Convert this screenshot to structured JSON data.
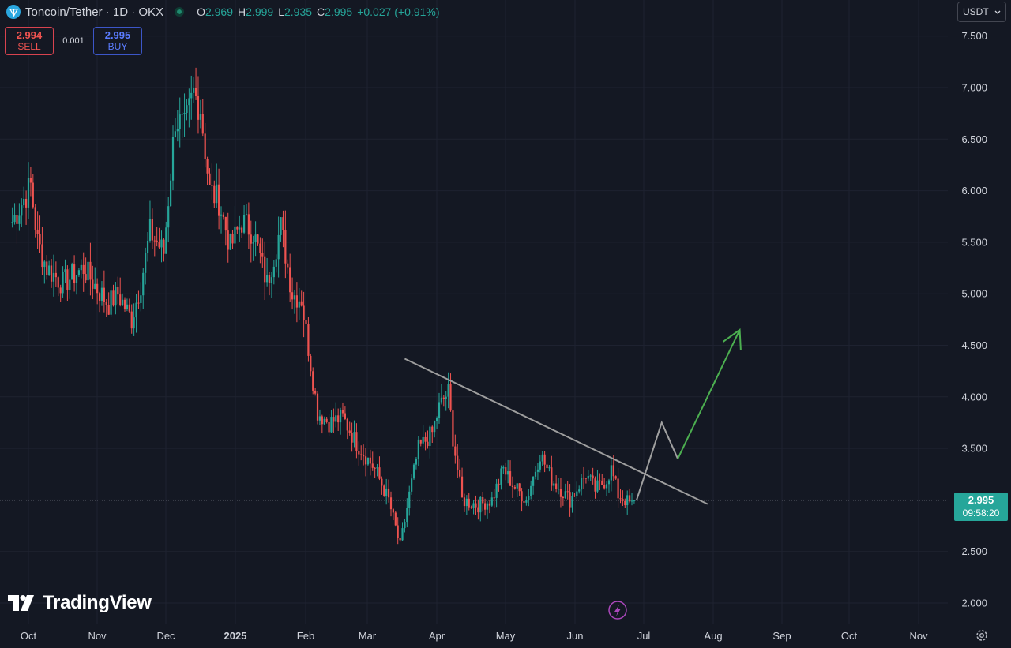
{
  "header": {
    "symbol": "Toncoin/Tether · 1D · OKX",
    "ohlc": [
      {
        "k": "O",
        "v": "2.969"
      },
      {
        "k": "H",
        "v": "2.999"
      },
      {
        "k": "L",
        "v": "2.935"
      },
      {
        "k": "C",
        "v": "2.995"
      }
    ],
    "change": "+0.027 (+0.91%)"
  },
  "trade": {
    "sell_price": "2.994",
    "sell_label": "SELL",
    "spread": "0.001",
    "buy_price": "2.995",
    "buy_label": "BUY"
  },
  "currency": "USDT",
  "last_price": {
    "value": "2.995",
    "countdown": "09:58:20"
  },
  "logo": "TradingView",
  "colors": {
    "background": "#141823",
    "up": "#26a69a",
    "down": "#ef5350",
    "trendline": "#9e9e9e",
    "projection_up": "#4caf50",
    "projection_path": "#a0a0a0"
  },
  "chart_data": {
    "type": "candlestick",
    "y_ticks": [
      "2.000",
      "2.500",
      "3.000",
      "3.500",
      "4.000",
      "4.500",
      "5.000",
      "5.500",
      "6.000",
      "6.500",
      "7.000",
      "7.500"
    ],
    "ylim": [
      2.0,
      7.5
    ],
    "x_ticks": [
      "Oct",
      "Nov",
      "Dec",
      "2025",
      "Feb",
      "Mar",
      "Apr",
      "May",
      "Jun",
      "Jul",
      "Aug",
      "Sep",
      "Oct",
      "Nov"
    ],
    "grid": true,
    "price_line": 2.995,
    "anchors": [
      [
        "2024-09-23",
        5.7
      ],
      [
        "2024-10-01",
        6.05
      ],
      [
        "2024-10-04",
        5.5
      ],
      [
        "2024-10-08",
        5.25
      ],
      [
        "2024-10-15",
        5.1
      ],
      [
        "2024-10-24",
        5.25
      ],
      [
        "2024-10-30",
        5.05
      ],
      [
        "2024-11-04",
        4.9
      ],
      [
        "2024-11-08",
        5.0
      ],
      [
        "2024-11-14",
        4.75
      ],
      [
        "2024-11-18",
        5.1
      ],
      [
        "2024-11-22",
        5.6
      ],
      [
        "2024-11-28",
        5.4
      ],
      [
        "2024-12-03",
        6.7
      ],
      [
        "2024-12-07",
        6.6
      ],
      [
        "2024-12-11",
        6.95
      ],
      [
        "2024-12-14",
        6.8
      ],
      [
        "2024-12-18",
        6.0
      ],
      [
        "2024-12-22",
        5.9
      ],
      [
        "2024-12-27",
        5.45
      ],
      [
        "2025-01-01",
        5.7
      ],
      [
        "2025-01-06",
        5.6
      ],
      [
        "2025-01-12",
        5.1
      ],
      [
        "2025-01-18",
        5.65
      ],
      [
        "2025-01-23",
        5.0
      ],
      [
        "2025-01-27",
        4.95
      ],
      [
        "2025-02-03",
        3.85
      ],
      [
        "2025-02-08",
        3.75
      ],
      [
        "2025-02-14",
        3.8
      ],
      [
        "2025-02-20",
        3.55
      ],
      [
        "2025-02-28",
        3.3
      ],
      [
        "2025-03-06",
        3.0
      ],
      [
        "2025-03-11",
        2.55
      ],
      [
        "2025-03-15",
        3.05
      ],
      [
        "2025-03-19",
        3.5
      ],
      [
        "2025-03-25",
        3.65
      ],
      [
        "2025-03-28",
        3.9
      ],
      [
        "2025-04-01",
        4.05
      ],
      [
        "2025-04-03",
        3.6
      ],
      [
        "2025-04-07",
        3.0
      ],
      [
        "2025-04-14",
        2.95
      ],
      [
        "2025-04-20",
        3.0
      ],
      [
        "2025-04-25",
        3.3
      ],
      [
        "2025-04-29",
        3.15
      ],
      [
        "2025-05-05",
        3.0
      ],
      [
        "2025-05-11",
        3.45
      ],
      [
        "2025-05-16",
        3.2
      ],
      [
        "2025-05-24",
        3.0
      ],
      [
        "2025-05-31",
        3.25
      ],
      [
        "2025-06-04",
        3.1
      ],
      [
        "2025-06-09",
        3.2
      ],
      [
        "2025-06-11",
        3.3
      ],
      [
        "2025-06-14",
        3.05
      ],
      [
        "2025-06-20",
        2.95
      ],
      [
        "2025-06-21",
        2.995
      ]
    ],
    "trendline": [
      [
        "2025-03-13",
        4.37
      ],
      [
        "2025-07-23",
        2.96
      ]
    ],
    "projection_path": [
      [
        "2025-06-22",
        2.995
      ],
      [
        "2025-07-03",
        3.75
      ],
      [
        "2025-07-10",
        3.4
      ]
    ],
    "projection_arrow": [
      [
        "2025-07-10",
        3.4
      ],
      [
        "2025-08-06",
        4.65
      ]
    ]
  }
}
